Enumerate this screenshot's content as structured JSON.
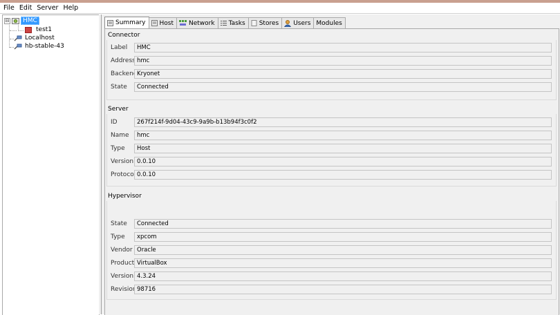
{
  "menu": [
    "File",
    "Edit",
    "Server",
    "Help"
  ],
  "tree": {
    "root": "HMC",
    "root_child": "test1",
    "nodes": [
      "Localhost",
      "hb-stable-43"
    ],
    "toggle_symbol": "⊟"
  },
  "tabs": [
    {
      "label": "Summary",
      "icon": "summary-icon",
      "active": true
    },
    {
      "label": "Host",
      "icon": "host-icon"
    },
    {
      "label": "Network",
      "icon": "network-icon"
    },
    {
      "label": "Tasks",
      "icon": "tasks-icon"
    },
    {
      "label": "Stores",
      "icon": "stores-icon"
    },
    {
      "label": "Users",
      "icon": "users-icon"
    },
    {
      "label": "Modules",
      "icon": null
    }
  ],
  "connector": {
    "title": "Connector",
    "fields": [
      {
        "label": "Label",
        "value": "HMC"
      },
      {
        "label": "Address",
        "value": "hmc"
      },
      {
        "label": "Backend",
        "value": "Kryonet"
      },
      {
        "label": "State",
        "value": "Connected"
      }
    ]
  },
  "server": {
    "title": "Server",
    "fields": [
      {
        "label": "ID",
        "value": "267f214f-9d04-43c9-9a9b-b13b94f3c0f2"
      },
      {
        "label": "Name",
        "value": "hmc"
      },
      {
        "label": "Type",
        "value": "Host"
      },
      {
        "label": "Version",
        "value": "0.0.10"
      },
      {
        "label": "Protocol",
        "value": "0.0.10"
      }
    ]
  },
  "hypervisor": {
    "title": "Hypervisor",
    "fields": [
      {
        "label": "State",
        "value": "Connected"
      },
      {
        "label": "Type",
        "value": "xpcom"
      },
      {
        "label": "Vendor",
        "value": "Oracle"
      },
      {
        "label": "Product",
        "value": "VirtualBox"
      },
      {
        "label": "Version",
        "value": "4.3.24"
      },
      {
        "label": "Revision",
        "value": "98716"
      }
    ]
  },
  "colors": {
    "selection": "#3399ff",
    "panel_bg": "#f0f0f0",
    "vm_icon": "#cc4444"
  }
}
